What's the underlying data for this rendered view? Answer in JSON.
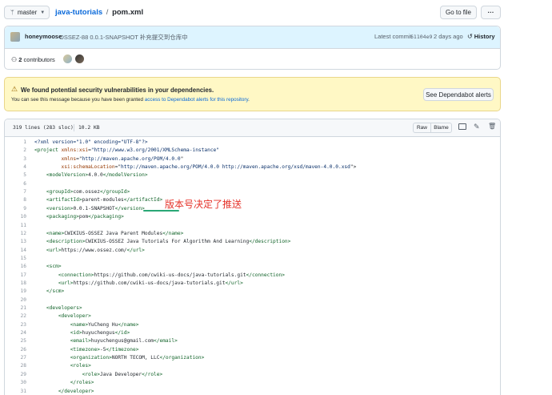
{
  "header": {
    "branch": "master",
    "repo": "java-tutorials",
    "separator": "/",
    "file": "pom.xml",
    "goto_file": "Go to file",
    "more": "···"
  },
  "commit": {
    "author": "honeymoose",
    "message": "OSSEZ-88 0.0.1-SNAPSHOT 补充提交到仓库中",
    "latest_label": "Latest commit",
    "sha": "61104e9",
    "time": "2 days ago",
    "history": "History"
  },
  "contributors": {
    "count": "2",
    "label": "contributors"
  },
  "alert": {
    "title": "We found potential security vulnerabilities in your dependencies.",
    "body_prefix": "You can see this message because you have been granted ",
    "body_link": "access to Dependabot alerts for this repository",
    "body_suffix": ".",
    "button": "See Dependabot alerts",
    "accent": "#9a6700",
    "background": "#fff8c5"
  },
  "file_info": {
    "lines": "319 lines (283 sloc)",
    "size": "10.2 KB",
    "raw": "Raw",
    "blame": "Blame"
  },
  "annotation": {
    "text": "版本号决定了推送",
    "color": "#e5332a"
  },
  "code": [
    {
      "n": "1",
      "t": "<?xml version=\"1.0\" encoding=\"UTF-8\"?>"
    },
    {
      "n": "2",
      "t": "<project xmlns:xsi=\"http://www.w3.org/2001/XMLSchema-instance\""
    },
    {
      "n": "3",
      "t": "         xmlns=\"http://maven.apache.org/POM/4.0.0\""
    },
    {
      "n": "4",
      "t": "         xsi:schemaLocation=\"http://maven.apache.org/POM/4.0.0 http://maven.apache.org/xsd/maven-4.0.0.xsd\">"
    },
    {
      "n": "5",
      "t": "    <modelVersion>4.0.0</modelVersion>"
    },
    {
      "n": "6",
      "t": ""
    },
    {
      "n": "7",
      "t": "    <groupId>com.ossez</groupId>"
    },
    {
      "n": "8",
      "t": "    <artifactId>parent-modules</artifactId>"
    },
    {
      "n": "9",
      "t": "    <version>0.0.1-SNAPSHOT</version>"
    },
    {
      "n": "10",
      "t": "    <packaging>pom</packaging>"
    },
    {
      "n": "11",
      "t": ""
    },
    {
      "n": "12",
      "t": "    <name>CWIKIUS-OSSEZ Java Parent Modules</name>"
    },
    {
      "n": "13",
      "t": "    <description>CWIKIUS-OSSEZ Java Tutorials For Algorithm And Learning</description>"
    },
    {
      "n": "14",
      "t": "    <url>https://www.ossez.com/</url>"
    },
    {
      "n": "15",
      "t": ""
    },
    {
      "n": "16",
      "t": "    <scm>"
    },
    {
      "n": "17",
      "t": "        <connection>https://github.com/cwiki-us-docs/java-tutorials.git</connection>"
    },
    {
      "n": "18",
      "t": "        <url>https://github.com/cwiki-us-docs/java-tutorials.git</url>"
    },
    {
      "n": "19",
      "t": "    </scm>"
    },
    {
      "n": "20",
      "t": ""
    },
    {
      "n": "21",
      "t": "    <developers>"
    },
    {
      "n": "22",
      "t": "        <developer>"
    },
    {
      "n": "23",
      "t": "            <name>YuCheng Hu</name>"
    },
    {
      "n": "24",
      "t": "            <id>huyuchengus</id>"
    },
    {
      "n": "25",
      "t": "            <email>huyuchengus@gmail.com</email>"
    },
    {
      "n": "26",
      "t": "            <timezone>-5</timezone>"
    },
    {
      "n": "27",
      "t": "            <organization>NORTH TECOM, LLC</organization>"
    },
    {
      "n": "28",
      "t": "            <roles>"
    },
    {
      "n": "29",
      "t": "                <role>Java Developer</role>"
    },
    {
      "n": "30",
      "t": "            </roles>"
    },
    {
      "n": "31",
      "t": "        </developer>"
    }
  ]
}
